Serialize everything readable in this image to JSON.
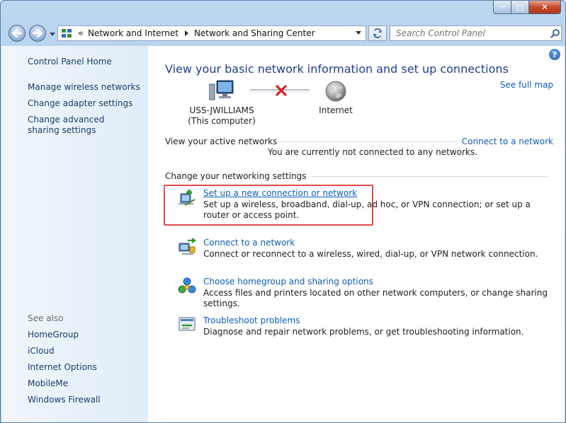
{
  "window": {
    "minimize_glyph": "—",
    "maximize_glyph": "□",
    "close_glyph": "✕"
  },
  "address": {
    "overflow": "«",
    "crumb1": "Network and Internet",
    "crumb2": "Network and Sharing Center"
  },
  "search": {
    "placeholder": "Search Control Panel"
  },
  "sidebar": {
    "home": "Control Panel Home",
    "links": [
      "Manage wireless networks",
      "Change adapter settings",
      "Change advanced sharing settings"
    ],
    "see_also_title": "See also",
    "see_also": [
      "HomeGroup",
      "iCloud",
      "Internet Options",
      "MobileMe",
      "Windows Firewall"
    ]
  },
  "main": {
    "help": "?",
    "heading": "View your basic network information and set up connections",
    "see_full_map": "See full map",
    "computer_name": "USS-JWILLIAMS",
    "computer_sub": "(This computer)",
    "internet": "Internet",
    "active_networks_label": "View your active networks",
    "connect_link": "Connect to a network",
    "not_connected": "You are currently not connected to any networks.",
    "change_settings_label": "Change your networking settings",
    "tasks": [
      {
        "title": "Set up a new connection or network",
        "desc": "Set up a wireless, broadband, dial-up, ad hoc, or VPN connection; or set up a router or access point."
      },
      {
        "title": "Connect to a network",
        "desc": "Connect or reconnect to a wireless, wired, dial-up, or VPN network connection."
      },
      {
        "title": "Choose homegroup and sharing options",
        "desc": "Access files and printers located on other network computers, or change sharing settings."
      },
      {
        "title": "Troubleshoot problems",
        "desc": "Diagnose and repair network problems, or get troubleshooting information."
      }
    ]
  },
  "colors": {
    "link": "#0d5dbf",
    "heading": "#1f3f8f",
    "highlight": "#e24b4b",
    "error_x": "#d42020"
  }
}
